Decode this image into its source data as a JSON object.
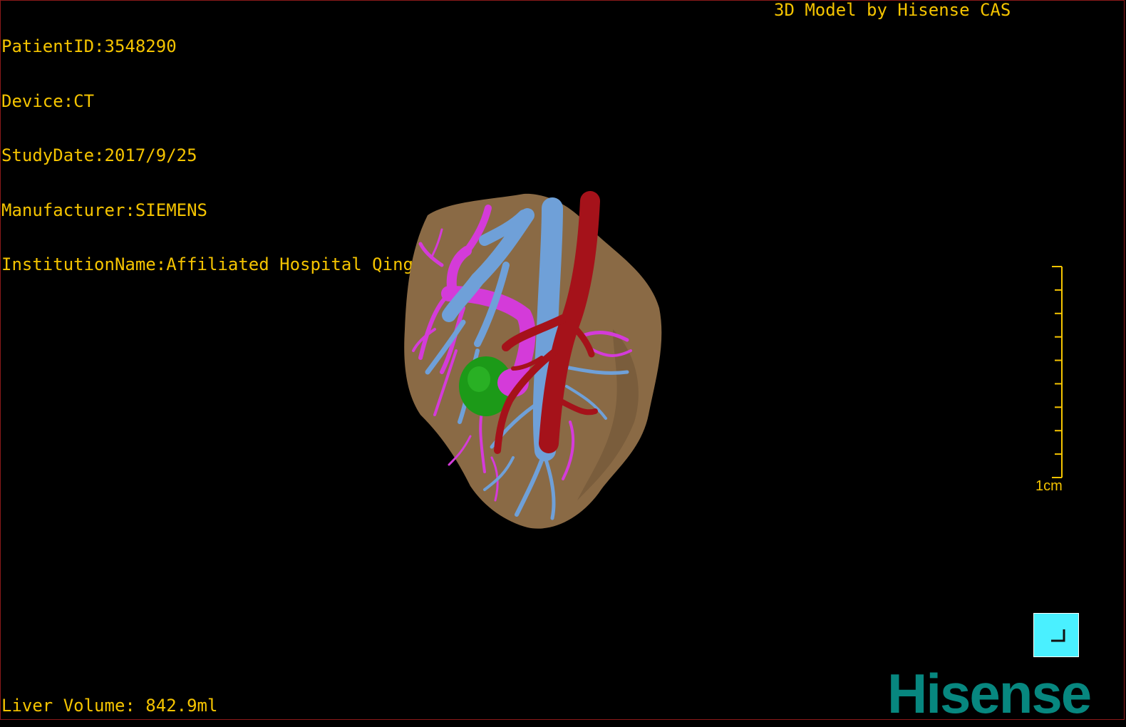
{
  "overlay": {
    "patient_id": "PatientID:3548290",
    "device": "Device:CT",
    "study_date": "StudyDate:2017/9/25",
    "manufacturer": "Manufacturer:SIEMENS",
    "institution": "InstitutionName:Affiliated Hospital Qingdao University-C",
    "brand_top": "3D Model by Hisense CAS",
    "liver_volume": "Liver Volume: 842.9ml"
  },
  "scale_bar": {
    "label": "1cm",
    "tick_count": 10
  },
  "logo": {
    "text": "Hisense"
  },
  "colors": {
    "overlay_text": "#f5c400",
    "liver": "#8a6a45",
    "portal_vein": "#6fa0d8",
    "hepatic_vein": "#d43bd9",
    "artery": "#a5121a",
    "lesion": "#1c9a18",
    "button": "#4af0ff",
    "logo": "#07877f"
  },
  "icons": {
    "corner_button": "restore-corner-icon"
  }
}
